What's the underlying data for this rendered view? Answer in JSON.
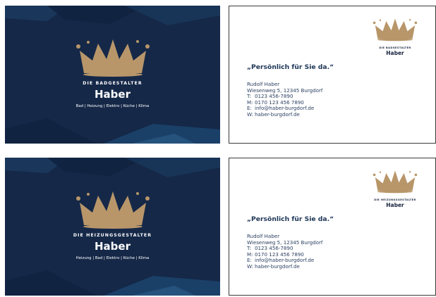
{
  "colors": {
    "navy": "#152848",
    "gold": "#b8966a",
    "text_blue": "#1d3556"
  },
  "brand": "Haber",
  "slogan": "„Persönlich für Sie da.“",
  "cards": [
    {
      "front": {
        "tagline": "DIE BADGESTALTER",
        "brand": "Haber",
        "services": "Bad | Heizung | Elektro | Küche | Klima"
      },
      "back": {
        "logo_tagline": "DIE BADGESTALTER",
        "logo_name": "Haber"
      }
    },
    {
      "front": {
        "tagline": "DIE HEIZUNGSGESTALTER",
        "brand": "Haber",
        "services": "Heizung | Bad | Elektro | Küche | Klima"
      },
      "back": {
        "logo_tagline": "DIE HEIZUNGSGESTALTER",
        "logo_name": "Haber"
      }
    }
  ],
  "contact": {
    "name": "Rudolf Haber",
    "address": "Wiesenweg 5, 12345 Burgdorf",
    "phone_label": "T:",
    "phone": "0123 456-7890",
    "mobile_label": "M:",
    "mobile": "0170 123 456 7890",
    "email_label": "E:",
    "email": "info@haber-burgdorf.de",
    "web_label": "W:",
    "web": "haber-burgdorf.de"
  }
}
